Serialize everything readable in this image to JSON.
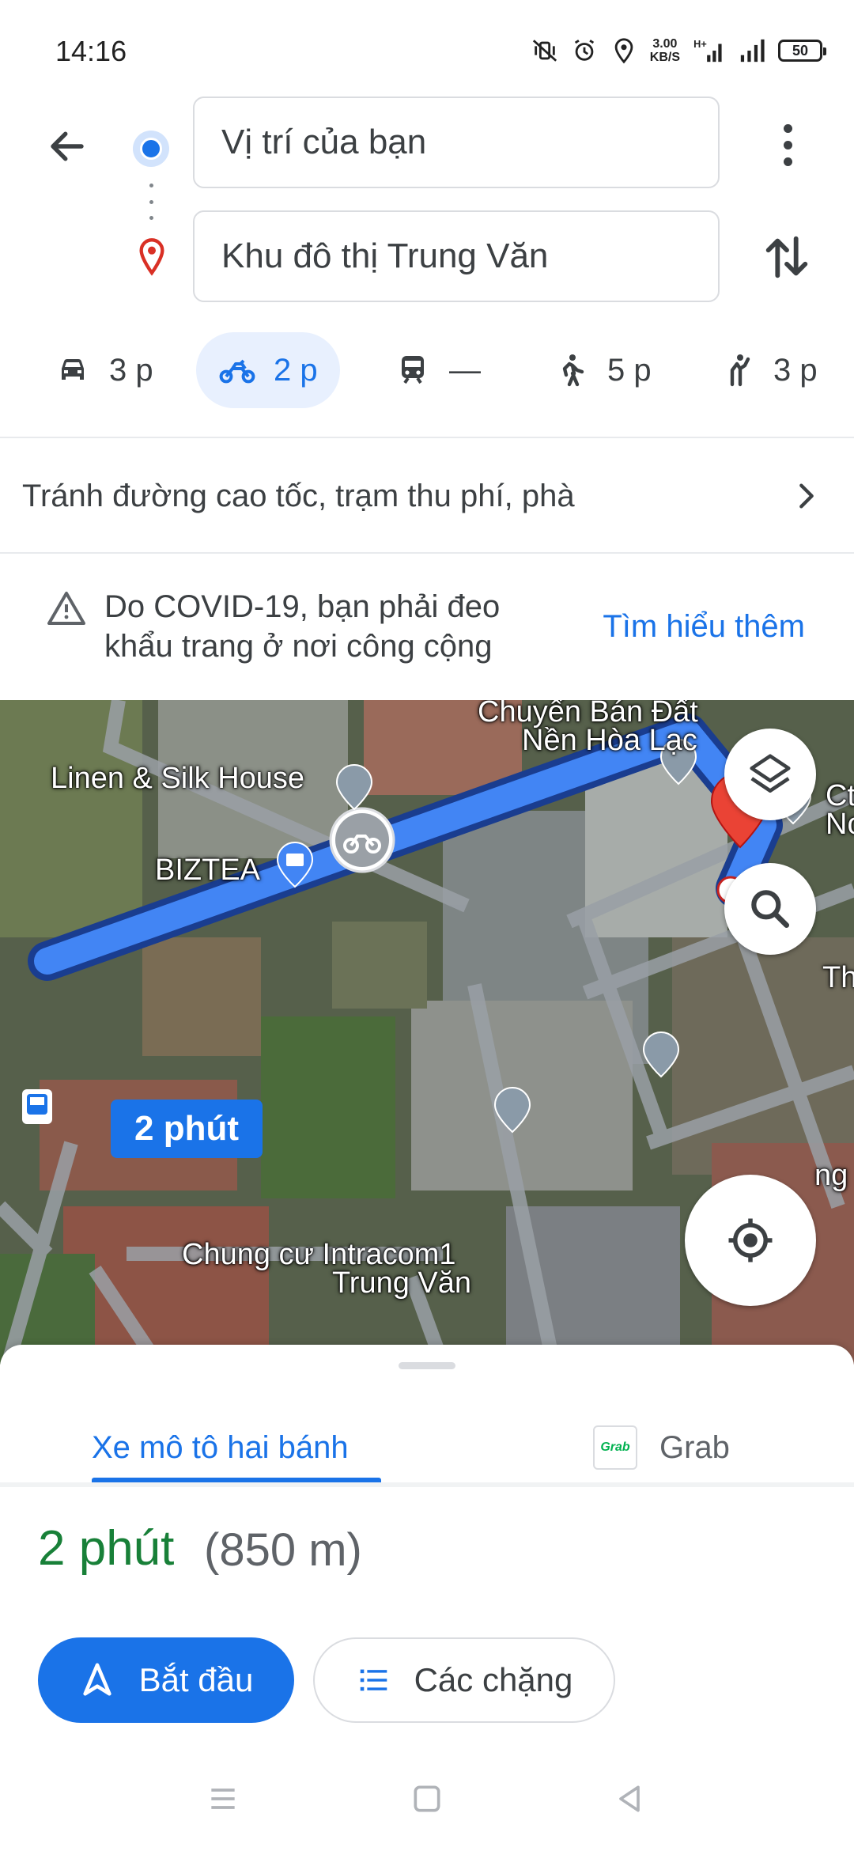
{
  "status_bar": {
    "time": "14:16",
    "net_speed_value": "3.00",
    "net_speed_unit": "KB/S",
    "battery": "50"
  },
  "directions": {
    "origin": "Vị trí của bạn",
    "destination": "Khu đô thị Trung Văn"
  },
  "modes": [
    {
      "name": "car",
      "label": "3 p"
    },
    {
      "name": "motorbike",
      "label": "2 p"
    },
    {
      "name": "transit",
      "label": "—"
    },
    {
      "name": "walk",
      "label": "5 p"
    },
    {
      "name": "ride-hailing",
      "label": "3 p"
    }
  ],
  "active_mode": "motorbike",
  "route_options": "Tránh đường cao tốc, trạm thu phí, phà",
  "covid_notice": {
    "line1": "Do COVID-19, bạn phải đeo",
    "line2": "khẩu trang ở nơi công cộng",
    "link": "Tìm hiểu thêm"
  },
  "map": {
    "labels": {
      "top_line1": "Chuyển Bán Đất",
      "top_line2": "Nền Hòa Lạc",
      "linen": "Linen & Silk House",
      "biztea": "BIZTEA",
      "right_top1": "Ct",
      "right_top2": "Nơ",
      "right_mid": "Th",
      "right_low": "ng",
      "intracom1": "Chung cư Intracom1",
      "intracom2": "Trung Văn"
    },
    "route_time": "2 phút",
    "route_color": "#4285f4"
  },
  "sheet": {
    "tab_active": "Xe mô tô hai bánh",
    "tab_other": "Grab",
    "grab_logo": "Grab",
    "eta": "2 phút",
    "distance": "(850 m)",
    "start": "Bắt đầu",
    "steps": "Các chặng"
  }
}
